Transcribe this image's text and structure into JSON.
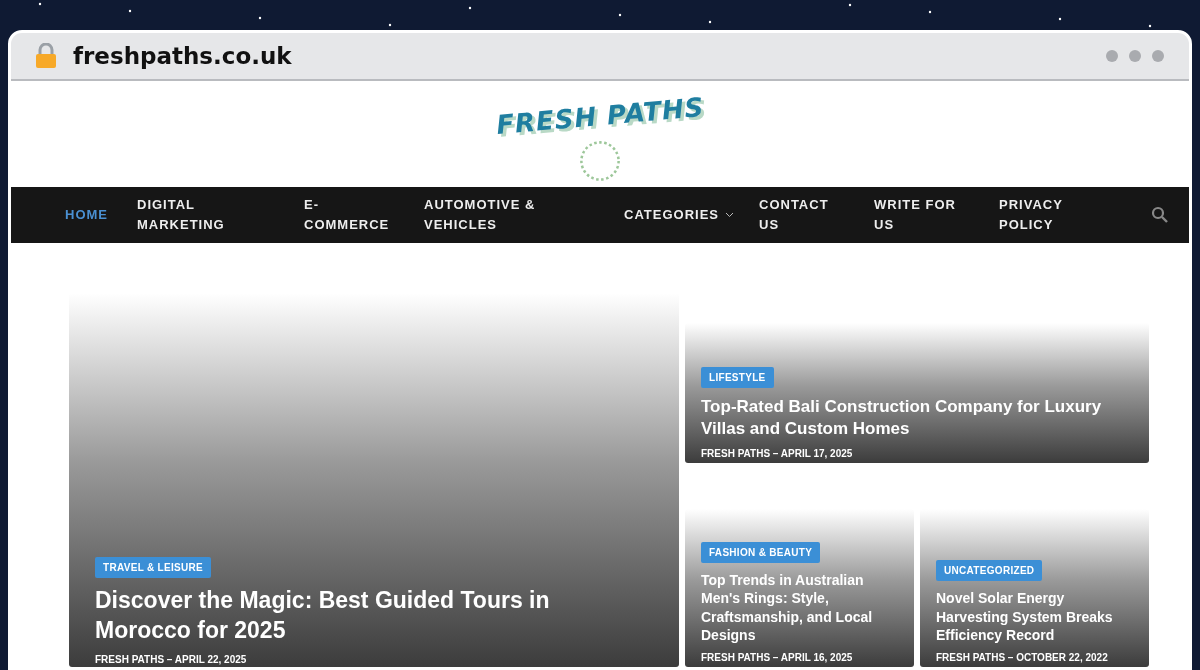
{
  "browser": {
    "url": "freshpaths.co.uk"
  },
  "logo": {
    "text": "FRESH PATHS"
  },
  "nav": [
    {
      "label": "HOME",
      "selected": true,
      "kind": "link"
    },
    {
      "label": "DIGITAL MARKETING",
      "selected": false,
      "kind": "link"
    },
    {
      "label": "E-COMMERCE",
      "selected": false,
      "kind": "link"
    },
    {
      "label": "AUTOMOTIVE & VEHICLES",
      "selected": false,
      "kind": "link"
    },
    {
      "label": "CATEGORIES",
      "selected": false,
      "kind": "dropdown"
    },
    {
      "label": "CONTACT US",
      "selected": false,
      "kind": "link"
    },
    {
      "label": "WRITE FOR US",
      "selected": false,
      "kind": "link"
    },
    {
      "label": "PRIVACY POLICY",
      "selected": false,
      "kind": "link"
    }
  ],
  "posts": [
    {
      "category": "TRAVEL & LEISURE",
      "title": "Discover the Magic: Best Guided Tours in Morocco for 2025",
      "meta": "FRESH PATHS – APRIL 22, 2025"
    },
    {
      "category": "LIFESTYLE",
      "title": "Top-Rated Bali Construction Company for Luxury Villas and Custom Homes",
      "meta": "FRESH PATHS – APRIL 17, 2025"
    },
    {
      "category": "FASHION & BEAUTY",
      "title": "Top Trends in Australian Men's Rings: Style, Craftsmanship, and Local Designs",
      "meta": "FRESH PATHS – APRIL 16, 2025"
    },
    {
      "category": "UNCATEGORIZED",
      "title": "Novel Solar Energy Harvesting System Breaks Efficiency Record",
      "meta": "FRESH PATHS – OCTOBER 22, 2022"
    }
  ]
}
